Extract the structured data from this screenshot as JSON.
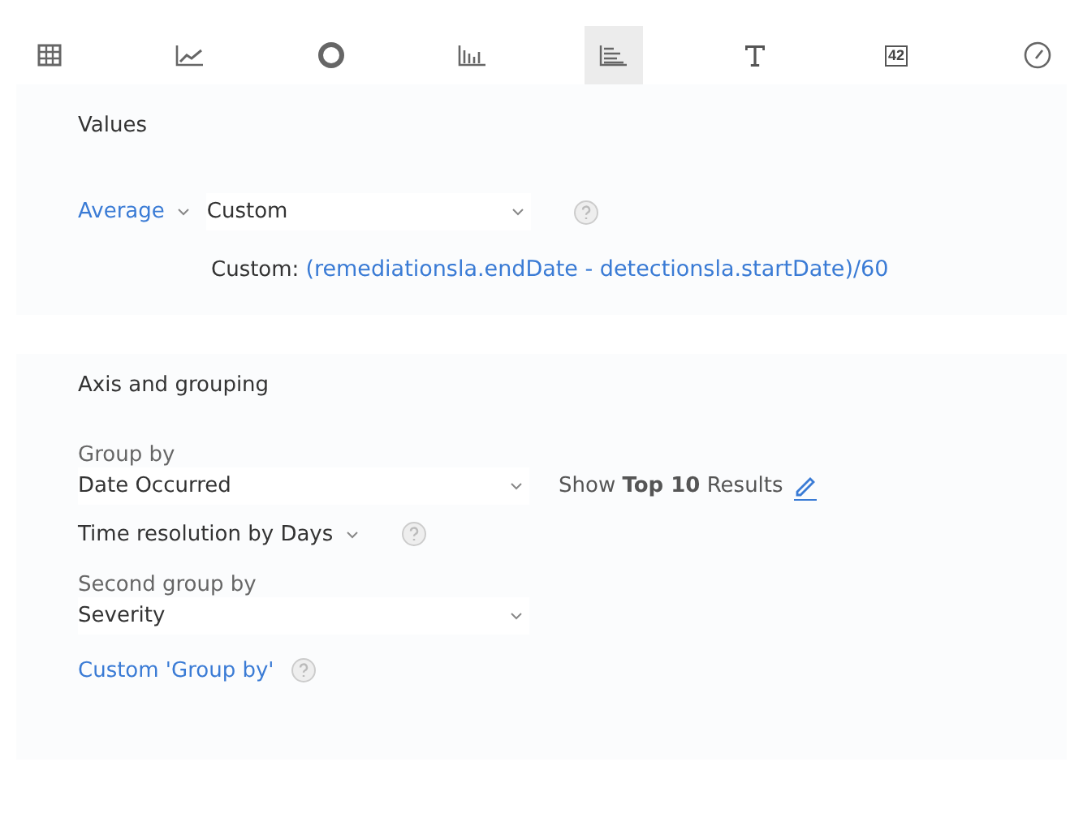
{
  "toolbar": [
    {
      "kind": "table",
      "selected": false
    },
    {
      "kind": "line",
      "selected": false
    },
    {
      "kind": "donut",
      "selected": false
    },
    {
      "kind": "bar",
      "selected": false
    },
    {
      "kind": "hbar",
      "selected": true
    },
    {
      "kind": "text",
      "selected": false
    },
    {
      "kind": "number",
      "label": "42",
      "selected": false
    },
    {
      "kind": "gauge",
      "selected": false
    }
  ],
  "values": {
    "title": "Values",
    "aggregate": "Average",
    "field": "Custom",
    "custom_label": "Custom:",
    "custom_formula": "(remediationsla.endDate - detectionsla.startDate)/60"
  },
  "axis": {
    "title": "Axis and grouping",
    "group_by_label": "Group by",
    "group_by": "Date Occurred",
    "show_top": "Show **Top 10** Results",
    "time_resolution": "Time resolution by Days",
    "second_group_label": "Second group by",
    "second_group": "Severity",
    "custom_group_link": "Custom 'Group by'"
  }
}
